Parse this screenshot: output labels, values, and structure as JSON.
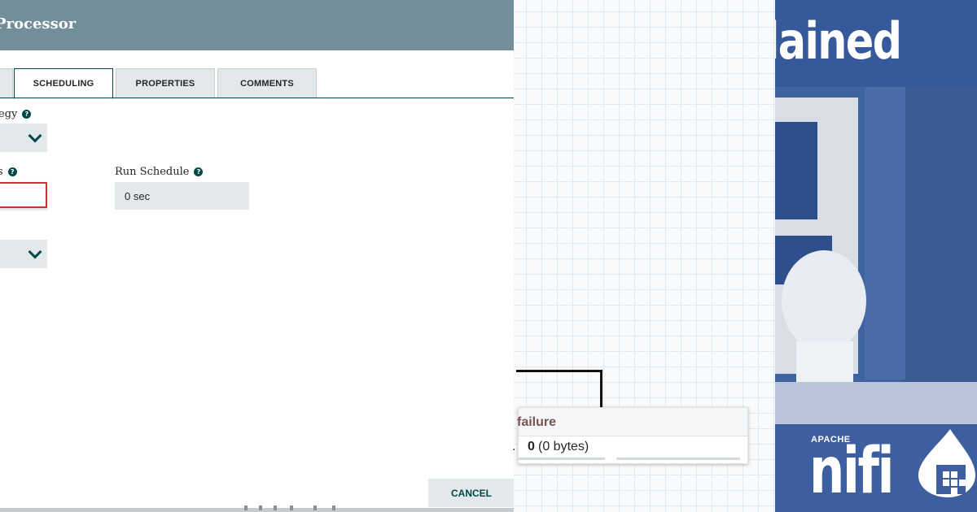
{
  "dialog": {
    "title": "Processor",
    "tabs": [
      {
        "label": "SCHEDULING",
        "active": true
      },
      {
        "label": "PROPERTIES",
        "active": false
      },
      {
        "label": "COMMENTS",
        "active": false
      }
    ],
    "fields": {
      "strategy_label_fragment": "egy",
      "tasks_label_fragment": "s",
      "run_schedule_label": "Run Schedule",
      "run_schedule_value": "0 sec",
      "help_glyph": "?"
    },
    "cancel_label": "CANCEL"
  },
  "canvas": {
    "connection": {
      "name": "failure",
      "queue_prefix": ".",
      "queued_count": "0",
      "queued_size": "(0 bytes)"
    }
  },
  "photo": {
    "title_fragment": "lained",
    "logo": {
      "apache": "APACHE",
      "name": "nifi"
    }
  },
  "colors": {
    "header": "#728e9b",
    "accent": "#004849",
    "invalid": "#d02f35",
    "connection_name": "#775351",
    "photo_blue": "#3b5f9e"
  },
  "icons": [
    "help-icon",
    "chevron-down-icon",
    "nifi-drop-icon"
  ]
}
